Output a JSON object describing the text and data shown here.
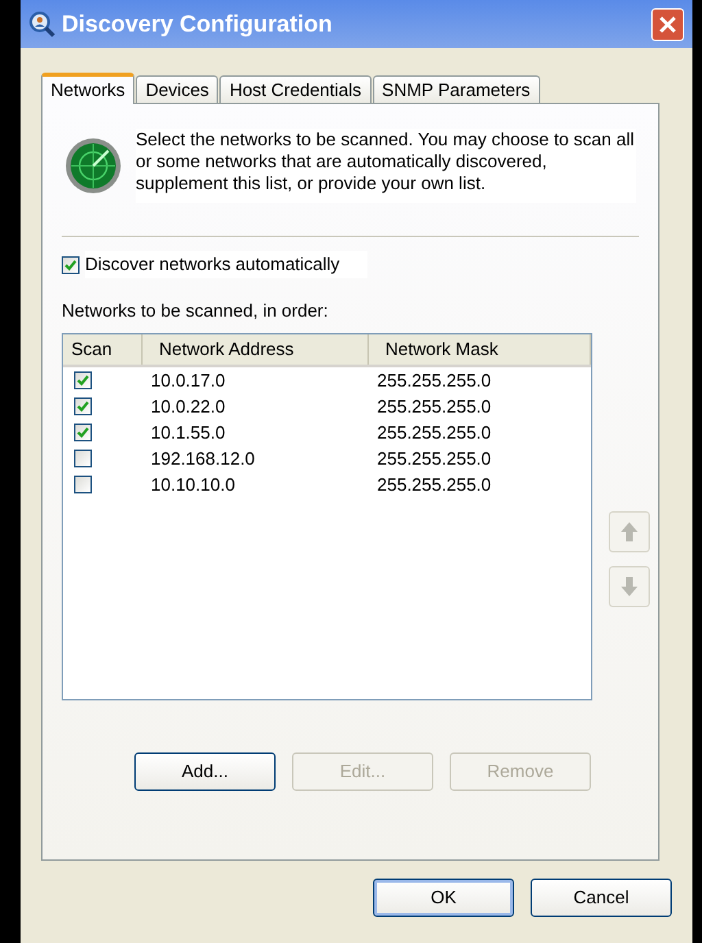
{
  "window": {
    "title": "Discovery Configuration"
  },
  "tabs": [
    {
      "label": "Networks",
      "selected": true
    },
    {
      "label": "Devices",
      "selected": false
    },
    {
      "label": "Host Credentials",
      "selected": false
    },
    {
      "label": "SNMP Parameters",
      "selected": false
    }
  ],
  "intro": "Select the networks to be scanned.  You may choose to scan all or some networks that are automatically discovered, supplement this list, or provide your own list.",
  "auto_discover": {
    "label": "Discover networks automatically",
    "checked": true
  },
  "list_label": "Networks to be scanned, in order:",
  "table": {
    "columns": [
      "Scan",
      "Network Address",
      "Network Mask"
    ],
    "rows": [
      {
        "checked": true,
        "address": "10.0.17.0",
        "mask": "255.255.255.0"
      },
      {
        "checked": true,
        "address": "10.0.22.0",
        "mask": "255.255.255.0"
      },
      {
        "checked": true,
        "address": "10.1.55.0",
        "mask": "255.255.255.0"
      },
      {
        "checked": false,
        "address": "192.168.12.0",
        "mask": "255.255.255.0"
      },
      {
        "checked": false,
        "address": "10.10.10.0",
        "mask": "255.255.255.0"
      }
    ]
  },
  "reorder_buttons": [
    {
      "kind": "up",
      "disabled": true
    },
    {
      "kind": "down",
      "disabled": true
    }
  ],
  "list_buttons": [
    {
      "label": "Add...",
      "disabled": false
    },
    {
      "label": "Edit...",
      "disabled": true
    },
    {
      "label": "Remove",
      "disabled": true
    }
  ],
  "dialog_buttons": [
    {
      "label": "OK",
      "default": true
    },
    {
      "label": "Cancel",
      "default": false
    }
  ]
}
